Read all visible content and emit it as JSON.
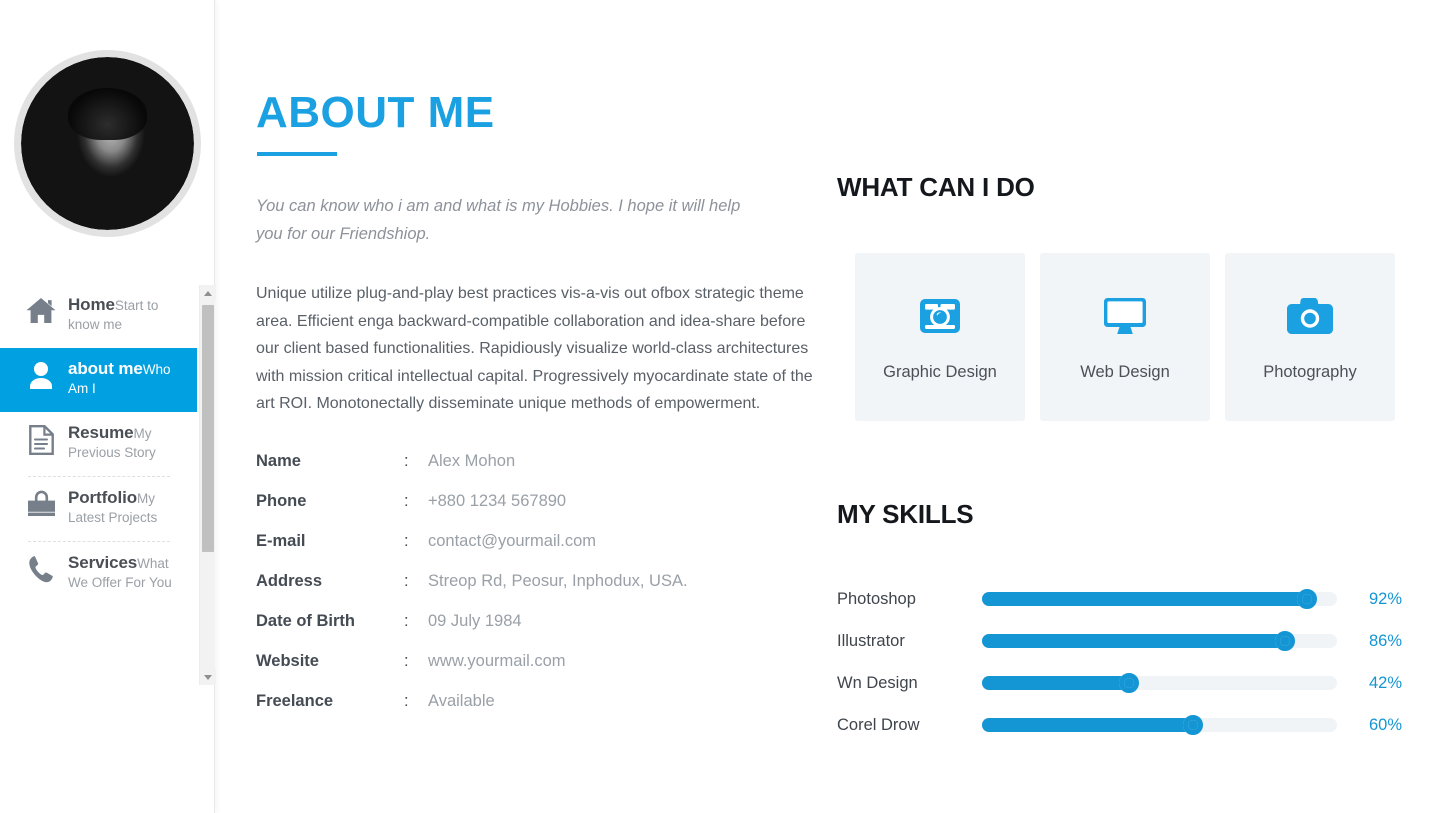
{
  "sidebar": {
    "avatar_alt": "profile-photo",
    "nav": [
      {
        "icon": "home-icon",
        "title": "Home",
        "subtitle": "Start to know me",
        "active": false,
        "divider_after": false
      },
      {
        "icon": "user-icon",
        "title": "about me",
        "subtitle": "Who Am I",
        "active": true,
        "divider_after": false
      },
      {
        "icon": "document-icon",
        "title": "Resume",
        "subtitle": "My Previous Story",
        "active": false,
        "divider_after": true
      },
      {
        "icon": "briefcase-icon",
        "title": "Portfolio",
        "subtitle": "My Latest Projects",
        "active": false,
        "divider_after": true
      },
      {
        "icon": "phone-icon",
        "title": "Services",
        "subtitle": "What We Offer For You",
        "active": false,
        "divider_after": false
      }
    ],
    "scrollbar": {
      "up_arrow": "▲",
      "down_arrow": "▼"
    }
  },
  "about": {
    "title": "ABOUT ME",
    "lede": "You can know who i am and what is my Hobbies. I hope it will help you for our Friendshiop.",
    "body": "Unique utilize plug-and-play best practices vis-a-vis out ofbox strategic theme area. Efficient enga backward-compatible collaboration and idea-share before our client based functionalities. Rapidiously visualize world-class architectures with mission critical intellectual capital. Progressively myocardinate state of the art ROI. Monotonectally disseminate unique methods of empowerment.",
    "info": [
      {
        "key": "Name",
        "sep": ":",
        "value": "Alex Mohon"
      },
      {
        "key": "Phone",
        "sep": ":",
        "value": "+880 1234 567890"
      },
      {
        "key": "E-mail",
        "sep": ":",
        "value": "contact@yourmail.com"
      },
      {
        "key": "Address",
        "sep": ":",
        "value": "Streop Rd, Peosur, Inphodux, USA."
      },
      {
        "key": "Date of Birth",
        "sep": ":",
        "value": "09 July 1984"
      },
      {
        "key": "Website",
        "sep": ":",
        "value": "www.yourmail.com"
      },
      {
        "key": "Freelance",
        "sep": ":",
        "value": "Available"
      }
    ]
  },
  "services": {
    "title": "WHAT CAN I DO",
    "cards": [
      {
        "icon": "camera-retro-icon",
        "label": "Graphic Design"
      },
      {
        "icon": "desktop-icon",
        "label": "Web Design"
      },
      {
        "icon": "camera-icon",
        "label": "Photography"
      }
    ]
  },
  "skills": {
    "title": "MY SKILLS",
    "items": [
      {
        "name": "Photoshop",
        "percent": 92,
        "percent_label": "92%"
      },
      {
        "name": "Illustrator",
        "percent": 86,
        "percent_label": "86%"
      },
      {
        "name": "Wn Design",
        "percent": 42,
        "percent_label": "42%"
      },
      {
        "name": "Corel Drow",
        "percent": 60,
        "percent_label": "60%"
      }
    ]
  },
  "colors": {
    "accent": "#1ba1e2",
    "accent_active_nav": "#00a0e1",
    "skill_bar": "#1496d4",
    "card_bg": "#f2f5f8",
    "heading_dark": "#14181c",
    "text_muted": "#9aa0a7"
  }
}
